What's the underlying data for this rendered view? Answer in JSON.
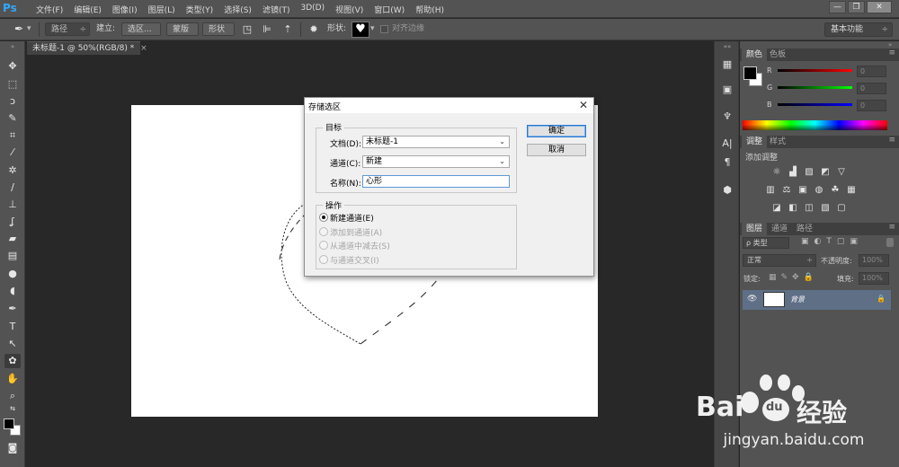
{
  "app": {
    "logo": "Ps",
    "menu": [
      "文件(F)",
      "编辑(E)",
      "图像(I)",
      "图层(L)",
      "类型(Y)",
      "选择(S)",
      "滤镜(T)",
      "3D(D)",
      "视图(V)",
      "窗口(W)",
      "帮助(H)"
    ],
    "window_controls": {
      "minimize": "—",
      "restore": "❐",
      "close": "✕"
    }
  },
  "options_bar": {
    "tool_icon": "pen-tool-icon",
    "path_mode": "路径",
    "make_label": "建立:",
    "selection_button": "选区...",
    "mask_button": "蒙版",
    "shape_button": "形状",
    "shape_label": "形状:",
    "shape_glyph": "♥",
    "align_edges_label": "对齐边缘",
    "workspace": "基本功能"
  },
  "document": {
    "tab_title": "未标题-1 @ 50%(RGB/8) *",
    "tab_close": "×"
  },
  "dialog": {
    "title": "存储选区",
    "close": "✕",
    "target_group": "目标",
    "doc_label": "文档(D):",
    "doc_value": "未标题-1",
    "channel_label": "通道(C):",
    "channel_value": "新建",
    "name_label": "名称(N):",
    "name_value": "心形",
    "ok_button": "确定",
    "cancel_button": "取消",
    "operation_group": "操作",
    "operations": [
      {
        "label": "新建通道(E)",
        "selected": true,
        "enabled": true
      },
      {
        "label": "添加到通道(A)",
        "selected": false,
        "enabled": false
      },
      {
        "label": "从通道中减去(S)",
        "selected": false,
        "enabled": false
      },
      {
        "label": "与通道交叉(I)",
        "selected": false,
        "enabled": false
      }
    ]
  },
  "color_panel": {
    "tabs": [
      "颜色",
      "色板"
    ],
    "channels": [
      {
        "label": "R",
        "value": "0"
      },
      {
        "label": "G",
        "value": "0"
      },
      {
        "label": "B",
        "value": "0"
      }
    ]
  },
  "adjustments_panel": {
    "tabs": [
      "调整",
      "样式"
    ],
    "title": "添加调整"
  },
  "layers_panel": {
    "tabs": [
      "图层",
      "通道",
      "路径"
    ],
    "filter_kind": "ρ 类型",
    "blend_mode": "正常",
    "opacity_label": "不透明度:",
    "opacity_value": "100%",
    "lock_label": "锁定:",
    "fill_label": "填充:",
    "fill_value": "100%",
    "layer_name": "背景"
  },
  "watermark": {
    "brand_left": "Bai",
    "brand_right": "du",
    "brand_cn": "经验",
    "url": "jingyan.baidu.com"
  },
  "colors": {
    "ps_blue": "#31a8ff",
    "chrome_dark": "#535353",
    "canvas_bg": "#282828",
    "layer_selected": "#5e6f86",
    "baidu_paw": "#ffffff"
  }
}
